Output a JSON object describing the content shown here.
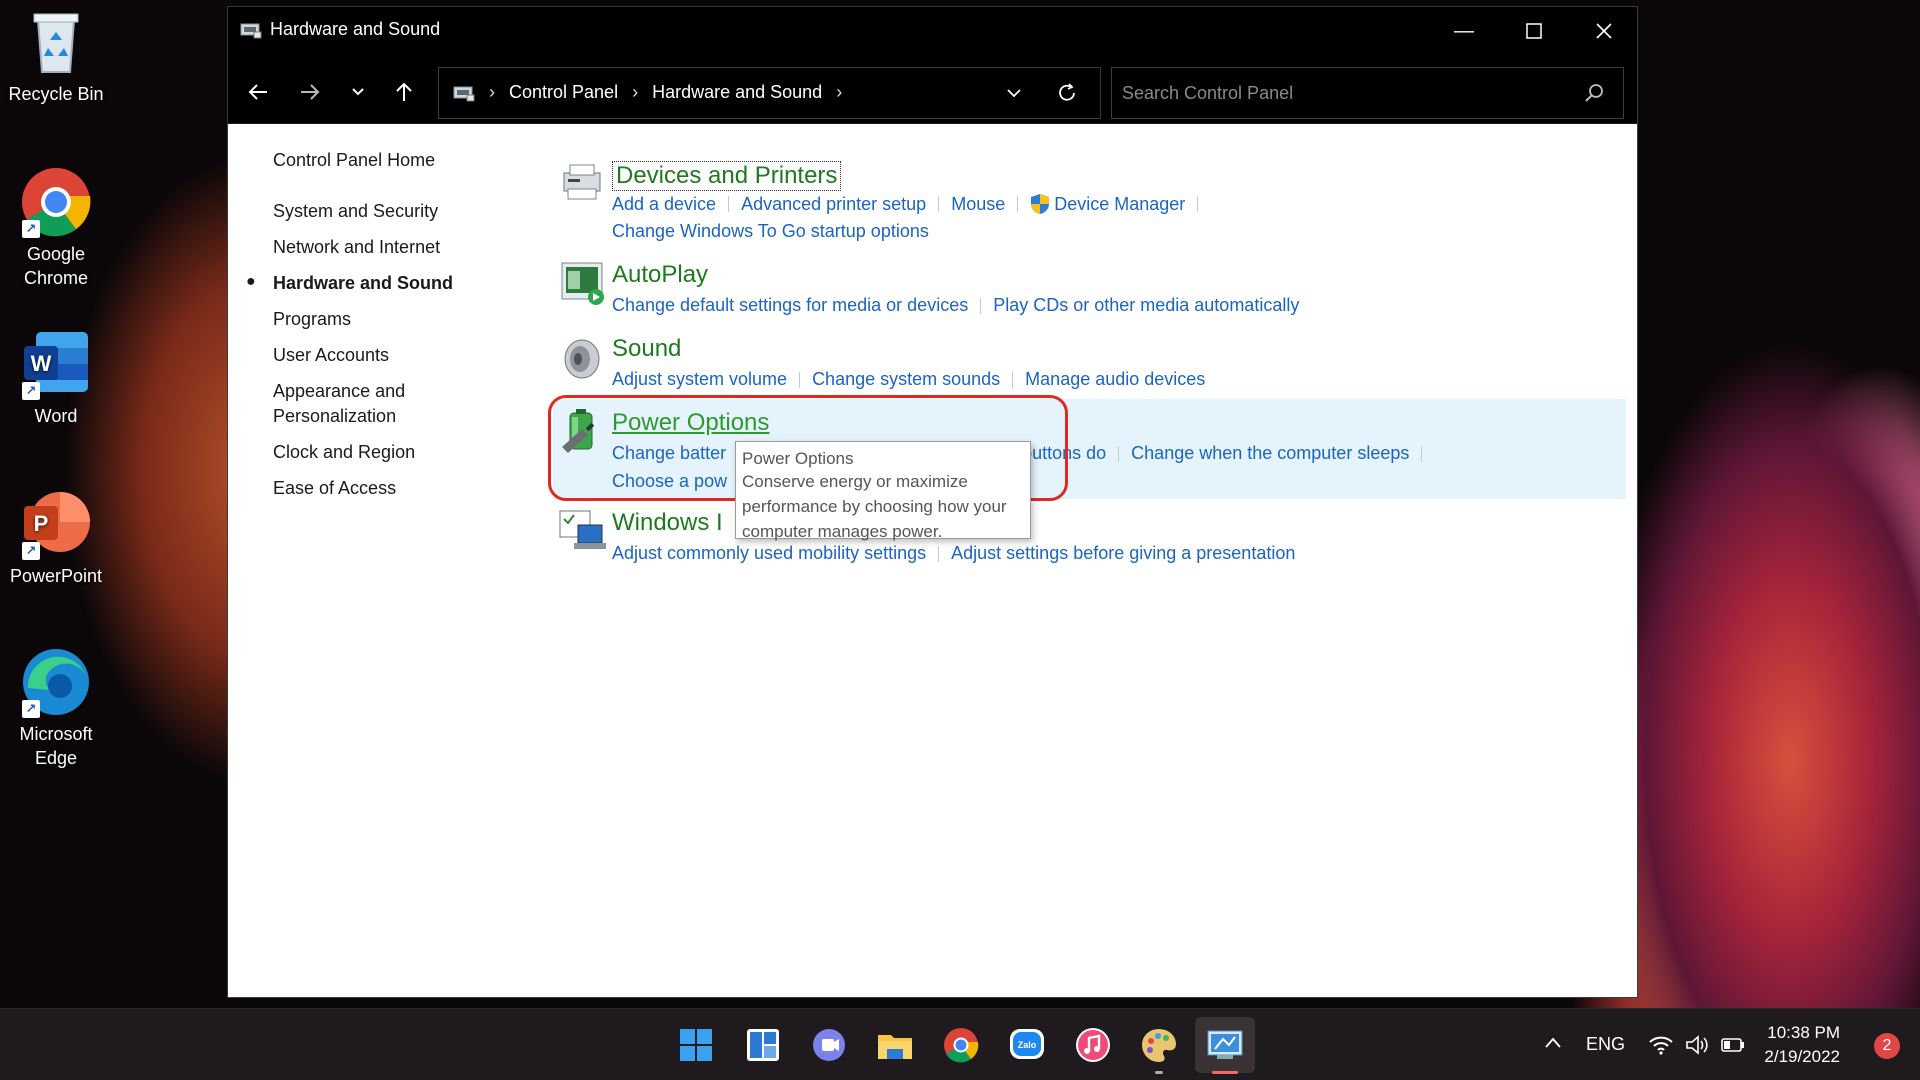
{
  "desktop": {
    "icons": [
      {
        "label": "Recycle Bin"
      },
      {
        "label": "Google Chrome"
      },
      {
        "label": "Word"
      },
      {
        "label": "PowerPoint"
      },
      {
        "label": "Microsoft Edge"
      }
    ]
  },
  "window": {
    "title": "Hardware and Sound",
    "breadcrumb": [
      "Control Panel",
      "Hardware and Sound"
    ],
    "search_placeholder": "Search Control Panel"
  },
  "leftpane": {
    "home": "Control Panel Home",
    "items": [
      "System and Security",
      "Network and Internet",
      "Hardware and Sound",
      "Programs",
      "User Accounts",
      "Appearance and",
      "Personalization",
      "Clock and Region",
      "Ease of Access"
    ]
  },
  "categories": {
    "devices": {
      "title": "Devices and Printers",
      "links": [
        "Add a device",
        "Advanced printer setup",
        "Mouse",
        "Device Manager"
      ],
      "links2": [
        "Change Windows To Go startup options"
      ]
    },
    "autoplay": {
      "title": "AutoPlay",
      "links": [
        "Change default settings for media or devices",
        "Play CDs or other media automatically"
      ]
    },
    "sound": {
      "title": "Sound",
      "links": [
        "Adjust system volume",
        "Change system sounds",
        "Manage audio devices"
      ]
    },
    "power": {
      "title": "Power Options",
      "link_partial_1": "Change batter",
      "link_partial_2": "buttons do",
      "link_3": "Change when the computer sleeps",
      "link_partial_4": "Choose a pow"
    },
    "mobility": {
      "title_partial": "Windows I",
      "link_partial_1": "Adjust commonly used mobility settings",
      "link_2": "Adjust settings before giving a presentation"
    }
  },
  "tooltip": {
    "title": "Power Options",
    "line1": "Conserve energy or maximize",
    "line2": "performance by choosing how your",
    "line3": "computer manages power."
  },
  "taskbar": {
    "language": "ENG",
    "time": "10:38 PM",
    "date": "2/19/2022",
    "notifications": "2"
  },
  "colors": {
    "link": "#1a64c2",
    "category_title": "#1e7a1e",
    "highlight": "#e5f3fc",
    "annotation": "#e02a20"
  }
}
